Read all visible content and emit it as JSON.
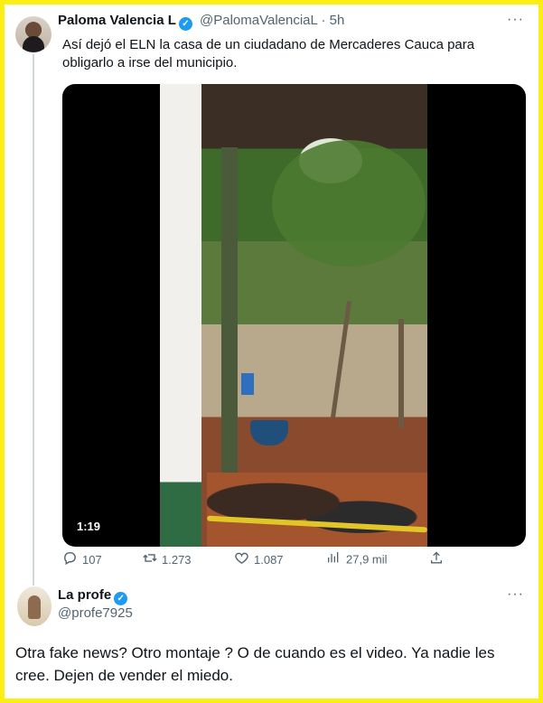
{
  "tweet": {
    "author_name": "Paloma Valencia L",
    "handle": "@PalomaValenciaL · 5h",
    "text": "Así dejó el ELN la casa de un ciudadano de Mercaderes Cauca para obligarlo a irse del municipio.",
    "more": "···",
    "video_duration": "1:19",
    "actions": {
      "replies": "107",
      "retweets": "1.273",
      "likes": "1.087",
      "views": "27,9 mil"
    }
  },
  "reply": {
    "author_name": "La profe",
    "handle": "@profe7925",
    "more": "···",
    "text": "Otra fake news? Otro montaje ? O de cuando es el video. Ya nadie les cree. Dejen de vender el miedo."
  },
  "colors": {
    "frame": "#fbee14",
    "verified": "#1d9bf0",
    "muted": "#536471"
  }
}
